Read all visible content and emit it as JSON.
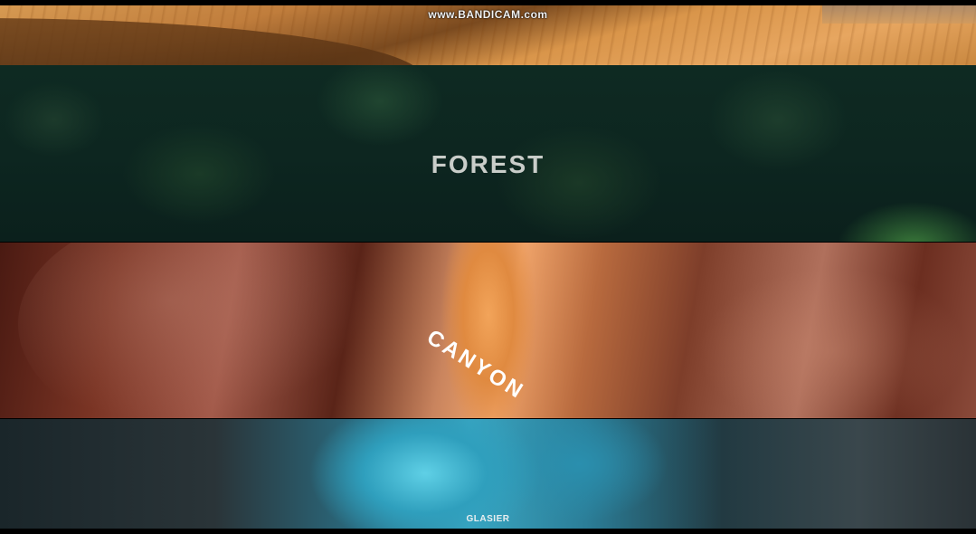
{
  "watermark": "www.BANDICAM.com",
  "sections": {
    "desert": {
      "label": ""
    },
    "forest": {
      "label": "FOREST"
    },
    "canyon": {
      "label": "CANYON"
    },
    "glacier": {
      "label": "GLASIER"
    }
  }
}
